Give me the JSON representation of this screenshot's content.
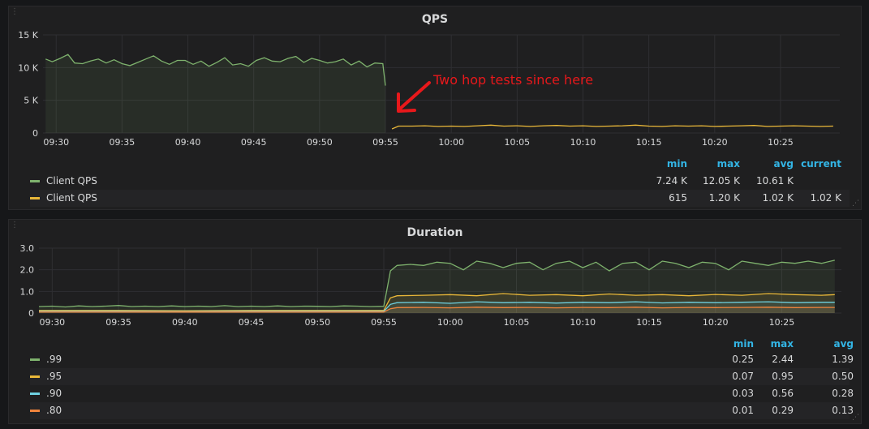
{
  "colors": {
    "green": "#7eb26d",
    "yellow": "#eab839",
    "blue": "#6ed0e0",
    "orange": "#ef843c",
    "annotation": "#e8181b",
    "header": "#33b5e5"
  },
  "qps_panel": {
    "title": "QPS",
    "annotation": "Two hop tests since here",
    "legend_headers": [
      "min",
      "max",
      "avg",
      "current"
    ],
    "legend": [
      {
        "name": "Client QPS",
        "color": "#7eb26d",
        "min": "7.24 K",
        "max": "12.05 K",
        "avg": "10.61 K",
        "current": ""
      },
      {
        "name": "Client QPS",
        "color": "#eab839",
        "min": "615",
        "max": "1.20 K",
        "avg": "1.02 K",
        "current": "1.02 K"
      }
    ]
  },
  "duration_panel": {
    "title": "Duration",
    "legend_headers": [
      "min",
      "max",
      "avg"
    ],
    "legend": [
      {
        "name": ".99",
        "color": "#7eb26d",
        "min": "0.25",
        "max": "2.44",
        "avg": "1.39"
      },
      {
        "name": ".95",
        "color": "#eab839",
        "min": "0.07",
        "max": "0.95",
        "avg": "0.50"
      },
      {
        "name": ".90",
        "color": "#6ed0e0",
        "min": "0.03",
        "max": "0.56",
        "avg": "0.28"
      },
      {
        "name": ".80",
        "color": "#ef843c",
        "min": "0.01",
        "max": "0.29",
        "avg": "0.13"
      }
    ]
  },
  "chart_data": [
    {
      "type": "line",
      "title": "QPS",
      "x_ticks": [
        "09:30",
        "09:35",
        "09:40",
        "09:45",
        "09:50",
        "09:55",
        "10:00",
        "10:05",
        "10:10",
        "10:15",
        "10:20",
        "10:25"
      ],
      "y_ticks": [
        "15 K",
        "10 K",
        "5 K",
        "0"
      ],
      "ylim": [
        0,
        15000
      ],
      "xlim_minutes": [
        -1,
        59.5
      ],
      "grid": true,
      "series": [
        {
          "name": "Client QPS",
          "color": "#7eb26d",
          "fill": true,
          "x": [
            -0.8,
            -0.3,
            0.3,
            0.9,
            1.4,
            2.0,
            2.6,
            3.2,
            3.8,
            4.4,
            5.0,
            5.6,
            6.2,
            6.8,
            7.4,
            8.0,
            8.6,
            9.2,
            9.8,
            10.4,
            11.0,
            11.6,
            12.2,
            12.8,
            13.4,
            14.0,
            14.6,
            15.2,
            15.8,
            16.4,
            17.0,
            17.6,
            18.2,
            18.8,
            19.4,
            20.0,
            20.6,
            21.2,
            21.8,
            22.4,
            23.0,
            23.6,
            24.2,
            24.8,
            25.0
          ],
          "values": [
            11300,
            10900,
            11400,
            12000,
            10700,
            10600,
            11000,
            11300,
            10700,
            11200,
            10600,
            10300,
            10800,
            11300,
            11800,
            11000,
            10500,
            11100,
            11100,
            10500,
            11000,
            10200,
            10800,
            11500,
            10400,
            10600,
            10200,
            11100,
            11500,
            11000,
            10900,
            11400,
            11700,
            10800,
            11400,
            11100,
            10700,
            10900,
            11300,
            10400,
            11000,
            10100,
            10700,
            10600,
            7240
          ]
        },
        {
          "name": "Client QPS",
          "color": "#eab839",
          "fill": false,
          "x": [
            25.5,
            26.0,
            27.0,
            28.0,
            29.0,
            30.0,
            31.0,
            32.0,
            33.0,
            34.0,
            35.0,
            36.0,
            37.0,
            38.0,
            39.0,
            40.0,
            41.0,
            42.0,
            43.0,
            44.0,
            45.0,
            46.0,
            47.0,
            48.0,
            49.0,
            50.0,
            51.0,
            52.0,
            53.0,
            54.0,
            55.0,
            56.0,
            57.0,
            58.0,
            59.0
          ],
          "values": [
            615,
            1050,
            1050,
            1100,
            1000,
            1050,
            1000,
            1100,
            1200,
            1050,
            1100,
            1000,
            1100,
            1150,
            1050,
            1100,
            1000,
            1050,
            1100,
            1200,
            1050,
            1000,
            1100,
            1050,
            1100,
            1000,
            1050,
            1100,
            1150,
            1000,
            1050,
            1100,
            1050,
            1000,
            1050
          ]
        }
      ]
    },
    {
      "type": "line",
      "title": "Duration",
      "x_ticks": [
        "09:30",
        "09:35",
        "09:40",
        "09:45",
        "09:50",
        "09:55",
        "10:00",
        "10:05",
        "10:10",
        "10:15",
        "10:20",
        "10:25"
      ],
      "y_ticks": [
        "3.0",
        "2.0",
        "1.0",
        "0"
      ],
      "ylim": [
        0,
        3
      ],
      "xlim_minutes": [
        -1,
        59.5
      ],
      "grid": true,
      "series": [
        {
          "name": ".99",
          "color": "#7eb26d",
          "fill": true,
          "x": [
            -1,
            0,
            1,
            2,
            3,
            4,
            5,
            6,
            7,
            8,
            9,
            10,
            11,
            12,
            13,
            14,
            15,
            16,
            17,
            18,
            19,
            20,
            21,
            22,
            23,
            24,
            25,
            25.5,
            26,
            27,
            28,
            29,
            30,
            31,
            32,
            33,
            34,
            35,
            36,
            37,
            38,
            39,
            40,
            41,
            42,
            43,
            44,
            45,
            46,
            47,
            48,
            49,
            50,
            51,
            52,
            53,
            54,
            55,
            56,
            57,
            58,
            59
          ],
          "values": [
            0.3,
            0.32,
            0.28,
            0.33,
            0.3,
            0.32,
            0.35,
            0.3,
            0.32,
            0.3,
            0.33,
            0.3,
            0.32,
            0.3,
            0.34,
            0.3,
            0.32,
            0.3,
            0.33,
            0.3,
            0.32,
            0.31,
            0.3,
            0.33,
            0.32,
            0.3,
            0.31,
            1.95,
            2.2,
            2.25,
            2.2,
            2.35,
            2.3,
            2.0,
            2.4,
            2.3,
            2.1,
            2.3,
            2.35,
            2.0,
            2.3,
            2.4,
            2.1,
            2.35,
            1.95,
            2.3,
            2.35,
            2.0,
            2.4,
            2.3,
            2.1,
            2.35,
            2.3,
            2.0,
            2.4,
            2.3,
            2.2,
            2.35,
            2.3,
            2.4,
            2.3,
            2.44
          ]
        },
        {
          "name": ".95",
          "color": "#eab839",
          "fill": true,
          "x": [
            -1,
            5,
            10,
            15,
            20,
            25,
            25.5,
            26,
            28,
            30,
            32,
            34,
            36,
            38,
            40,
            42,
            44,
            46,
            48,
            50,
            52,
            54,
            56,
            58,
            59
          ],
          "values": [
            0.12,
            0.12,
            0.11,
            0.12,
            0.12,
            0.12,
            0.7,
            0.8,
            0.82,
            0.85,
            0.8,
            0.9,
            0.82,
            0.85,
            0.8,
            0.88,
            0.82,
            0.85,
            0.8,
            0.86,
            0.82,
            0.9,
            0.85,
            0.82,
            0.85
          ]
        },
        {
          "name": ".90",
          "color": "#6ed0e0",
          "fill": true,
          "x": [
            -1,
            5,
            10,
            15,
            20,
            25,
            25.5,
            26,
            28,
            30,
            32,
            34,
            36,
            38,
            40,
            42,
            44,
            46,
            48,
            50,
            52,
            54,
            56,
            58,
            59
          ],
          "values": [
            0.08,
            0.08,
            0.07,
            0.08,
            0.08,
            0.08,
            0.4,
            0.48,
            0.5,
            0.45,
            0.52,
            0.48,
            0.5,
            0.46,
            0.5,
            0.48,
            0.52,
            0.47,
            0.5,
            0.48,
            0.5,
            0.52,
            0.48,
            0.5,
            0.5
          ]
        },
        {
          "name": ".80",
          "color": "#ef843c",
          "fill": true,
          "x": [
            -1,
            5,
            10,
            15,
            20,
            25,
            25.5,
            26,
            28,
            30,
            32,
            34,
            36,
            38,
            40,
            42,
            44,
            46,
            48,
            50,
            52,
            54,
            56,
            58,
            59
          ],
          "values": [
            0.05,
            0.05,
            0.05,
            0.05,
            0.05,
            0.05,
            0.2,
            0.25,
            0.26,
            0.24,
            0.27,
            0.25,
            0.26,
            0.24,
            0.26,
            0.25,
            0.27,
            0.24,
            0.26,
            0.25,
            0.26,
            0.27,
            0.25,
            0.26,
            0.26
          ]
        }
      ]
    }
  ]
}
